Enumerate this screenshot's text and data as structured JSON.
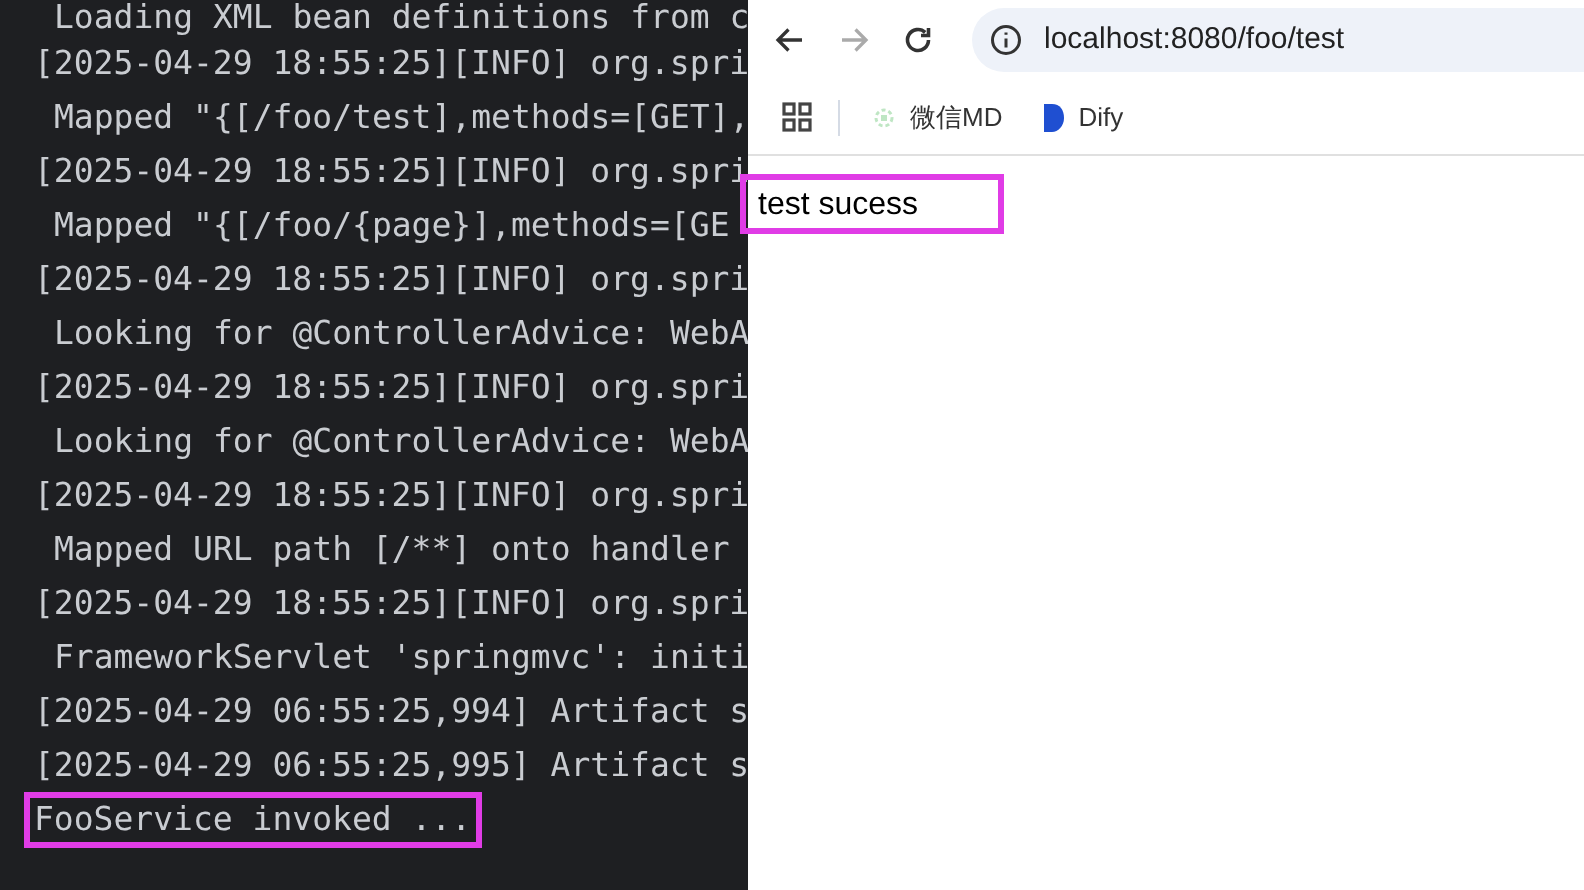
{
  "console": {
    "lines": [
      {
        "kind": "detail",
        "text": "Loading XML bean definitions from c",
        "highlighted": false
      },
      {
        "kind": "log",
        "text": "[2025-04-29 18:55:25][INFO] org.spri",
        "highlighted": false
      },
      {
        "kind": "detail",
        "text": "Mapped \"{[/foo/test],methods=[GET],",
        "highlighted": false
      },
      {
        "kind": "log",
        "text": "[2025-04-29 18:55:25][INFO] org.spri",
        "highlighted": false
      },
      {
        "kind": "detail",
        "text": "Mapped \"{[/foo/{page}],methods=[GE",
        "highlighted": false
      },
      {
        "kind": "log",
        "text": "[2025-04-29 18:55:25][INFO] org.spri",
        "highlighted": false
      },
      {
        "kind": "detail",
        "text": "Looking for @ControllerAdvice: WebA",
        "highlighted": false
      },
      {
        "kind": "log",
        "text": "[2025-04-29 18:55:25][INFO] org.spri",
        "highlighted": false
      },
      {
        "kind": "detail",
        "text": "Looking for @ControllerAdvice: WebA",
        "highlighted": false
      },
      {
        "kind": "log",
        "text": "[2025-04-29 18:55:25][INFO] org.spri",
        "highlighted": false
      },
      {
        "kind": "detail",
        "text": "Mapped URL path [/**] onto handler",
        "highlighted": false
      },
      {
        "kind": "log",
        "text": "[2025-04-29 18:55:25][INFO] org.spri",
        "highlighted": false
      },
      {
        "kind": "detail",
        "text": "FrameworkServlet 'springmvc': initi",
        "highlighted": false
      },
      {
        "kind": "log",
        "text": "[2025-04-29 06:55:25,994] Artifact s",
        "highlighted": false
      },
      {
        "kind": "log",
        "text": "[2025-04-29 06:55:25,995] Artifact s",
        "highlighted": false
      },
      {
        "kind": "log",
        "text": "FooService invoked ...",
        "highlighted": true
      }
    ]
  },
  "browser": {
    "url": "localhost:8080/foo/test",
    "bookmarks": [
      "微信MD",
      "Dify"
    ],
    "page_text": "test sucess",
    "page_text_highlighted": true
  }
}
